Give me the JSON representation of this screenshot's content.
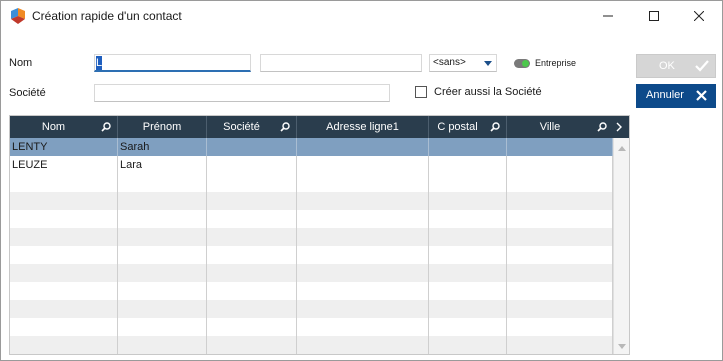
{
  "window": {
    "title": "Création rapide d'un contact",
    "controls": [
      "minimize",
      "maximize",
      "close"
    ]
  },
  "form": {
    "nom_label": "Nom",
    "nom_value": "L",
    "prenom_value": "",
    "civilite_selected": "<sans>",
    "entreprise_label": "Entreprise",
    "entreprise_on": true,
    "societe_label": "Société",
    "societe_value": "",
    "creer_societe_label": "Créer aussi la Société",
    "creer_societe_checked": false
  },
  "buttons": {
    "ok_label": "OK",
    "ok_enabled": false,
    "cancel_label": "Annuler"
  },
  "grid": {
    "columns": [
      "Nom",
      "Prénom",
      "Société",
      "Adresse ligne1",
      "C postal",
      "Ville"
    ],
    "searchable_columns": [
      "Nom",
      "Société",
      "C postal",
      "Ville"
    ],
    "rows": [
      [
        "LENTY",
        "Sarah",
        "",
        "",
        "",
        ""
      ],
      [
        "LEUZE",
        "Lara",
        "",
        "",
        "",
        ""
      ]
    ],
    "selected_row": 0
  },
  "colors": {
    "header_bg": "#2a3d4d",
    "selected_row": "#7f9fc0",
    "cancel_button": "#0d4a8a",
    "ok_button_disabled": "#d6d6d6",
    "toggle_on": "#4cc84c"
  },
  "icons": {
    "app": "vcard-logo-icon",
    "header_search": "search-icon",
    "header_next": "chevron-right-icon",
    "ok": "checkmark-icon",
    "cancel": "close-x-icon"
  }
}
